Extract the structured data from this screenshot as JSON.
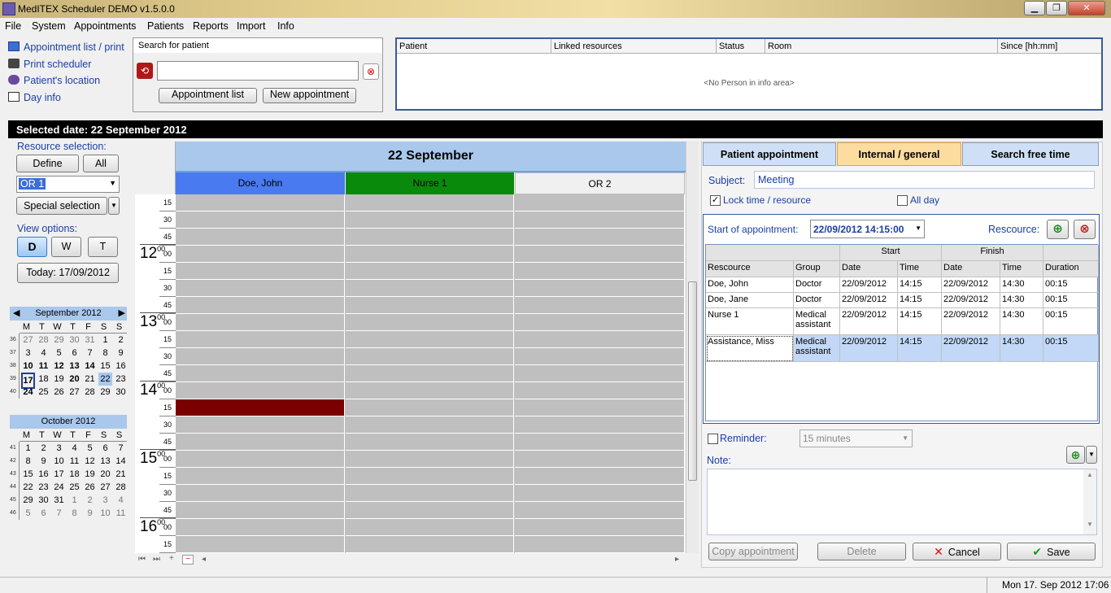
{
  "window": {
    "title": "MedITEX  Scheduler DEMO v1.5.0.0",
    "min": "▁",
    "max": "❐",
    "close": "✕"
  },
  "menu": [
    "File",
    "System",
    "Appointments",
    "Patients",
    "Reports",
    "Import",
    "Info"
  ],
  "links": [
    {
      "label": "Appointment list / print",
      "icon": "list-icon"
    },
    {
      "label": "Print scheduler",
      "icon": "printer-icon"
    },
    {
      "label": "Patient's location",
      "icon": "people-icon"
    },
    {
      "label": "Day info",
      "icon": "note-icon"
    }
  ],
  "search": {
    "title": "Search for patient",
    "value": "",
    "btn_list": "Appointment list",
    "btn_new": "New appointment"
  },
  "info": {
    "columns": [
      "Patient",
      "Linked resources",
      "Status",
      "Room",
      "Since [hh:mm]"
    ],
    "empty": "<No Person in info area>"
  },
  "selected_date": "Selected date: 22 September 2012",
  "left": {
    "resource_label": "Resource selection:",
    "define": "Define",
    "all": "All",
    "resource_value": "OR 1",
    "special": "Special selection",
    "view_label": "View options:",
    "view_d": "D",
    "view_w": "W",
    "view_t": "T",
    "today": "Today: 17/09/2012"
  },
  "cal_sep": {
    "title": "September 2012",
    "days": [
      "M",
      "T",
      "W",
      "T",
      "F",
      "S",
      "S"
    ],
    "weeks": [
      {
        "wk": "36",
        "d": [
          "27",
          "28",
          "29",
          "30",
          "31",
          "1",
          "2"
        ]
      },
      {
        "wk": "37",
        "d": [
          "3",
          "4",
          "5",
          "6",
          "7",
          "8",
          "9"
        ]
      },
      {
        "wk": "38",
        "d": [
          "10",
          "11",
          "12",
          "13",
          "14",
          "15",
          "16"
        ]
      },
      {
        "wk": "39",
        "d": [
          "17",
          "18",
          "19",
          "20",
          "21",
          "22",
          "23"
        ]
      },
      {
        "wk": "40",
        "d": [
          "24",
          "25",
          "26",
          "27",
          "28",
          "29",
          "30"
        ]
      }
    ]
  },
  "cal_oct": {
    "title": "October 2012",
    "days": [
      "M",
      "T",
      "W",
      "T",
      "F",
      "S",
      "S"
    ],
    "weeks": [
      {
        "wk": "41",
        "d": [
          "1",
          "2",
          "3",
          "4",
          "5",
          "6",
          "7"
        ]
      },
      {
        "wk": "42",
        "d": [
          "8",
          "9",
          "10",
          "11",
          "12",
          "13",
          "14"
        ]
      },
      {
        "wk": "43",
        "d": [
          "15",
          "16",
          "17",
          "18",
          "19",
          "20",
          "21"
        ]
      },
      {
        "wk": "44",
        "d": [
          "22",
          "23",
          "24",
          "25",
          "26",
          "27",
          "28"
        ]
      },
      {
        "wk": "45",
        "d": [
          "29",
          "30",
          "31",
          "1",
          "2",
          "3",
          "4"
        ]
      },
      {
        "wk": "46",
        "d": [
          "5",
          "6",
          "7",
          "8",
          "9",
          "10",
          "11"
        ]
      }
    ]
  },
  "scheduler": {
    "day_title": "22 September",
    "columns": [
      {
        "name": "Doe, John",
        "color": "#4a7af0"
      },
      {
        "name": "Nurse 1",
        "color": "#0a8a0a"
      },
      {
        "name": "OR 2",
        "color": "#f0f0f0"
      }
    ],
    "appointment_color": "#7a0000",
    "times": [
      {
        "t": "15",
        "h": ""
      },
      {
        "t": "30",
        "h": ""
      },
      {
        "t": "45",
        "h": ""
      },
      {
        "t": "00",
        "h": "12"
      },
      {
        "t": "15",
        "h": ""
      },
      {
        "t": "30",
        "h": ""
      },
      {
        "t": "45",
        "h": ""
      },
      {
        "t": "00",
        "h": "13"
      },
      {
        "t": "15",
        "h": ""
      },
      {
        "t": "30",
        "h": ""
      },
      {
        "t": "45",
        "h": ""
      },
      {
        "t": "00",
        "h": "14"
      },
      {
        "t": "15",
        "h": ""
      },
      {
        "t": "30",
        "h": ""
      },
      {
        "t": "45",
        "h": ""
      },
      {
        "t": "00",
        "h": "15"
      },
      {
        "t": "15",
        "h": ""
      },
      {
        "t": "30",
        "h": ""
      },
      {
        "t": "45",
        "h": ""
      },
      {
        "t": "00",
        "h": "16"
      },
      {
        "t": "15",
        "h": ""
      }
    ]
  },
  "tabs": [
    "Patient appointment",
    "Internal / general",
    "Search free time"
  ],
  "form": {
    "subject_label": "Subject:",
    "subject": "Meeting",
    "lock": "Lock time / resource",
    "allday": "All day",
    "start_label": "Start of appointment:",
    "start_value": "22/09/2012 14:15:00",
    "resource_label": "Rescource:",
    "reminder": "Reminder:",
    "reminder_value": "15 minutes",
    "note": "Note:",
    "copy": "Copy appointment",
    "delete": "Delete",
    "cancel": "Cancel",
    "save": "Save"
  },
  "table": {
    "group_start": "Start",
    "group_finish": "Finish",
    "headers": [
      "Rescource",
      "Group",
      "Date",
      "Time",
      "Date",
      "Time",
      "Duration"
    ],
    "rows": [
      [
        "Doe, John",
        "Doctor",
        "22/09/2012",
        "14:15",
        "22/09/2012",
        "14:30",
        "00:15"
      ],
      [
        "Doe, Jane",
        "Doctor",
        "22/09/2012",
        "14:15",
        "22/09/2012",
        "14:30",
        "00:15"
      ],
      [
        "Nurse 1",
        "Medical assistant",
        "22/09/2012",
        "14:15",
        "22/09/2012",
        "14:30",
        "00:15"
      ],
      [
        "Assistance, Miss",
        "Medical assistant",
        "22/09/2012",
        "14:15",
        "22/09/2012",
        "14:30",
        "00:15"
      ]
    ]
  },
  "status": "Mon 17. Sep 2012 17:06"
}
